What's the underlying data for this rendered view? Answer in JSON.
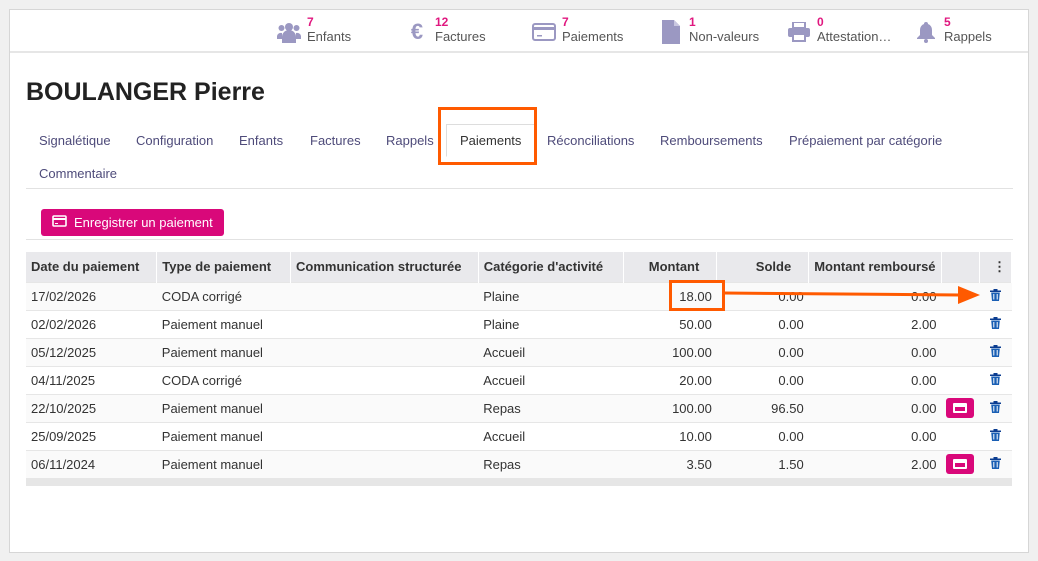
{
  "stats": [
    {
      "count": "7",
      "label": "Enfants",
      "icon": "users-icon"
    },
    {
      "count": "12",
      "label": "Factures",
      "icon": "euro-icon"
    },
    {
      "count": "7",
      "label": "Paiements",
      "icon": "credit-card-icon"
    },
    {
      "count": "1",
      "label": "Non-valeurs",
      "icon": "file-icon"
    },
    {
      "count": "0",
      "label": "Attestation…",
      "icon": "printer-icon"
    },
    {
      "count": "5",
      "label": "Rappels",
      "icon": "bell-icon"
    }
  ],
  "title": "BOULANGER Pierre",
  "tabs": [
    "Signalétique",
    "Configuration",
    "Enfants",
    "Factures",
    "Rappels",
    "Paiements",
    "Réconciliations",
    "Remboursements",
    "Prépaiement par catégorie",
    "Commentaire"
  ],
  "register_button": "Enregistrer un paiement",
  "table": {
    "headers": [
      "Date du paiement",
      "Type de paiement",
      "Communication structurée",
      "Catégorie d'activité",
      "Montant",
      "Solde",
      "Montant remboursé"
    ],
    "rows": [
      {
        "date": "17/02/2026",
        "type": "CODA corrigé",
        "comm": "",
        "cat": "Plaine",
        "montant": "18.00",
        "solde": "0.00",
        "rembourse": "0.00",
        "pay": false
      },
      {
        "date": "02/02/2026",
        "type": "Paiement manuel",
        "comm": "",
        "cat": "Plaine",
        "montant": "50.00",
        "solde": "0.00",
        "rembourse": "2.00",
        "pay": false
      },
      {
        "date": "05/12/2025",
        "type": "Paiement manuel",
        "comm": "",
        "cat": "Accueil",
        "montant": "100.00",
        "solde": "0.00",
        "rembourse": "0.00",
        "pay": false
      },
      {
        "date": "04/11/2025",
        "type": "CODA corrigé",
        "comm": "",
        "cat": "Accueil",
        "montant": "20.00",
        "solde": "0.00",
        "rembourse": "0.00",
        "pay": false
      },
      {
        "date": "22/10/2025",
        "type": "Paiement manuel",
        "comm": "",
        "cat": "Repas",
        "montant": "100.00",
        "solde": "96.50",
        "rembourse": "0.00",
        "pay": true
      },
      {
        "date": "25/09/2025",
        "type": "Paiement manuel",
        "comm": "",
        "cat": "Accueil",
        "montant": "10.00",
        "solde": "0.00",
        "rembourse": "0.00",
        "pay": false
      },
      {
        "date": "06/11/2024",
        "type": "Paiement manuel",
        "comm": "",
        "cat": "Repas",
        "montant": "3.50",
        "solde": "1.50",
        "rembourse": "2.00",
        "pay": true
      }
    ]
  },
  "colors": {
    "accent": "#d9087a",
    "annotation": "#ff5a00"
  }
}
